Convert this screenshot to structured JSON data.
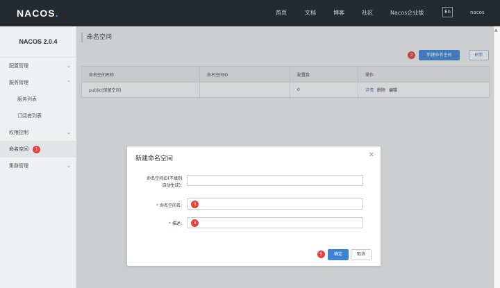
{
  "header": {
    "logo": "NACOS",
    "nav": [
      "首页",
      "文档",
      "博客",
      "社区",
      "Nacos企业版"
    ],
    "lang": "En",
    "user": "nacos"
  },
  "sidebar": {
    "version": "NACOS 2.0.4",
    "items": [
      {
        "label": "配置管理",
        "expand": "down"
      },
      {
        "label": "服务管理",
        "expand": "up"
      },
      {
        "label": "服务列表"
      },
      {
        "label": "订阅者列表"
      },
      {
        "label": "权限控制",
        "expand": "down"
      },
      {
        "label": "命名空间",
        "active": true,
        "badge": "1"
      },
      {
        "label": "集群管理",
        "expand": "down"
      }
    ]
  },
  "main": {
    "title": "命名空间",
    "new_badge": "2",
    "new_button": "新建命名空间",
    "refresh_button": "刷新",
    "table": {
      "headers": [
        "命名空间名称",
        "命名空间ID",
        "配置数",
        "操作"
      ],
      "rows": [
        {
          "name": "public(保留空间)",
          "id": "",
          "count": "0",
          "ops": [
            "详情",
            "删除",
            "编辑"
          ]
        }
      ]
    }
  },
  "modal": {
    "title": "新建命名空间",
    "fields": [
      {
        "label_line1": "命名空间ID(不填则",
        "label_line2": "自动生成):",
        "badge": ""
      },
      {
        "label": "命名空间名:",
        "required": true,
        "badge": "3"
      },
      {
        "label": "描述:",
        "required": true,
        "badge": "4"
      }
    ],
    "ok_badge": "5",
    "ok_button": "确定",
    "cancel_button": "取消"
  },
  "colors": {
    "topbar": "#252a2f",
    "primary": "#3b82d8",
    "badge": "#e8403a"
  }
}
